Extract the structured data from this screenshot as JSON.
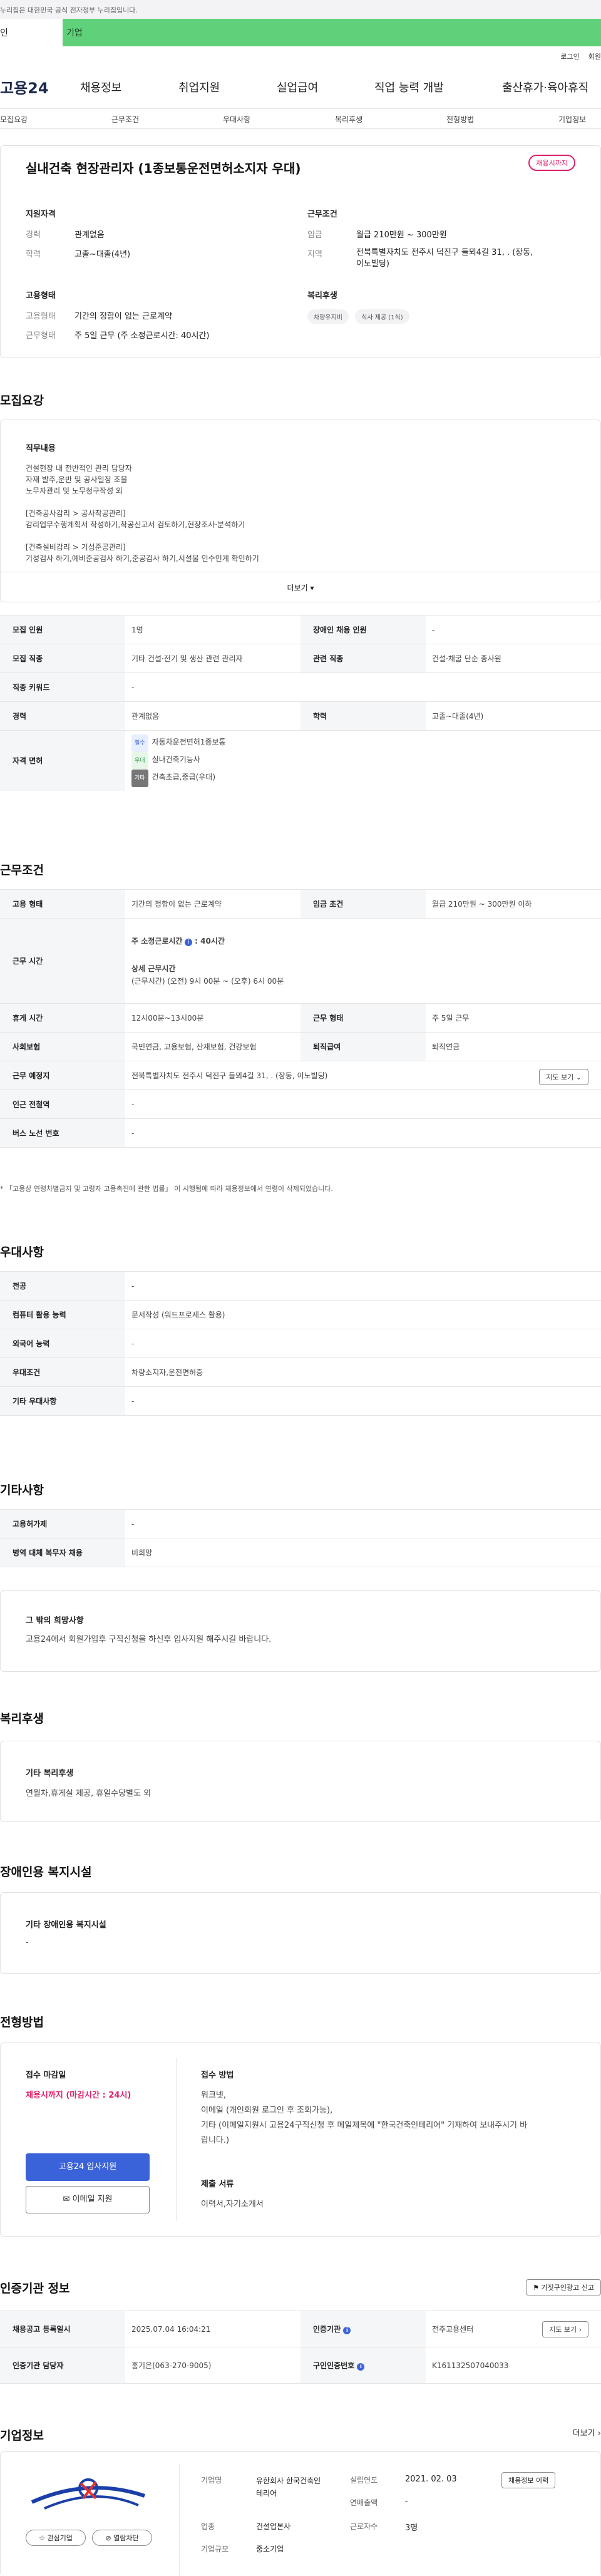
{
  "gov_banner": "누리집은 대한민국 공식 전자정부 누리집입니다.",
  "tabs": {
    "personal": "인",
    "corporate": "기업"
  },
  "util": {
    "login": "로그인",
    "join": "회원"
  },
  "logo": "고용24",
  "gnb": [
    "채용정보",
    "취업지원",
    "실업급여",
    "직업 능력 개발",
    "출산휴가·육아휴직"
  ],
  "subnav": [
    "모집요강",
    "근무조건",
    "우대사항",
    "복리후생",
    "전형방법",
    "기업정보"
  ],
  "job": {
    "title": "실내건축 현장관리자 (1종보통운전면허소지자 우대)",
    "status_badge": "채용시까지",
    "qualification_heading": "지원자격",
    "career_label": "경력",
    "career_value": "관계없음",
    "education_label": "학력",
    "education_value": "고졸~대졸(4년)",
    "conditions_heading": "근무조건",
    "wage_label": "임금",
    "wage_value": "월급 210만원 ~ 300만원",
    "region_label": "지역",
    "region_value": "전북특별자치도 전주시 덕진구 들뫼4길 31, . (장동, 이노빌딩)",
    "employment_heading": "고용형태",
    "emp_type_label": "고용형태",
    "emp_type_value": "기간의 정함이 없는 근로계약",
    "work_form_label": "근무형태",
    "work_form_value": "주 5일 근무 (주 소정근로시간: 40시간)",
    "welfare_heading": "복리후생",
    "welfare_chips": [
      "차량유지비",
      "식사 제공 (1식)"
    ]
  },
  "recruit": {
    "title": "모집요강",
    "duty_heading": "직무내용",
    "duty_lines": [
      "건설현장 내 전반적인 관리 담당자",
      "자재 발주,운반 및 공사일정 조율",
      "노무자관리 및 노무청구작성 외",
      "",
      "[건축공사감리 > 공사착공관리]",
      "감리업무수행계획서 작성하기,착공신고서 검토하기,현장조사·분석하기",
      "",
      "[건축설비감리 > 기성준공관리]",
      "기성검사 하기,예비준공검사 하기,준공검사 하기,시설물 인수인계 확인하기"
    ],
    "more": "더보기",
    "rows": [
      {
        "h1": "모집 인원",
        "v1": "1명",
        "h2": "장애인 채용 인원",
        "v2": "-"
      },
      {
        "h1": "모집 직종",
        "v1": "기타 건설·전기 및 생산 관련 관리자",
        "h2": "관련 직종",
        "v2": "건설·채굴 단순 종사원"
      },
      {
        "h1": "직종 키워드",
        "v1": "-",
        "h2": "",
        "v2": ""
      },
      {
        "h1": "경력",
        "v1": "관계없음",
        "h2": "학력",
        "v2": "고졸~대졸(4년)"
      }
    ],
    "license_label": "자격 면허",
    "licenses": [
      {
        "tag": "필수",
        "text": "자동차운전면허1종보통"
      },
      {
        "tag": "우대",
        "text": "실내건축기능사"
      },
      {
        "tag": "기타",
        "text": "건축초급,중급(우대)"
      }
    ]
  },
  "work": {
    "title": "근무조건",
    "emp_type_h": "고용 형태",
    "emp_type_v": "기간의 정함이 없는 근로계약",
    "wage_h": "임금 조건",
    "wage_v": "월급 210만원 ~ 300만원 이하",
    "hours_h": "근무 시간",
    "hours_week_label": "주 소정근로시간",
    "hours_week_value": ": 40시간",
    "hours_detail_label": "상세 근무시간",
    "hours_detail_value": "(근무시간) (오전) 9시 00분 ~ (오후) 6시 00분",
    "rest_h": "휴게 시간",
    "rest_v": "12시00분~13시00분",
    "form_h": "근무 형태",
    "form_v": "주 5일 근무",
    "insurance_h": "사회보험",
    "insurance_v": "국민연금, 고용보험, 산재보험, 건강보험",
    "pension_h": "퇴직급여",
    "pension_v": "퇴직연금",
    "place_h": "근무 예정지",
    "place_v": "전북특별자치도 전주시 덕진구 들뫼4길 31, . (장동, 이노빌딩)",
    "map_btn": "지도 보기",
    "subway_h": "인근 전철역",
    "subway_v": "-",
    "bus_h": "버스 노선 번호",
    "bus_v": "-",
    "footnote": "「고용상 연령차별금지 및 고령자 고용촉진에 관한 법률」 이 시행됨에 따라 채용정보에서 연령이 삭제되었습니다."
  },
  "pref": {
    "title": "우대사항",
    "rows": [
      {
        "h": "전공",
        "v": "-"
      },
      {
        "h": "컴퓨터 활용 능력",
        "v": "문서작성 (워드프로세스 활용)"
      },
      {
        "h": "외국어 능력",
        "v": "-"
      },
      {
        "h": "우대조건",
        "v": "차량소지자,운전면허증"
      },
      {
        "h": "기타 우대사항",
        "v": "-"
      }
    ]
  },
  "etc": {
    "title": "기타사항",
    "rows": [
      {
        "h": "고용허가제",
        "v": "-"
      },
      {
        "h": "병역 대체 복무자 채용",
        "v": "비희망"
      }
    ],
    "other_heading": "그 밖의 희망사항",
    "other_text": "고용24에서 회원가입후 구직신청을 하신후 입사지원 해주시길 바랍니다."
  },
  "welfare": {
    "title": "복리후생",
    "heading": "기타 복리후생",
    "text": "연월차,휴게실 제공, 휴일수당별도 외"
  },
  "disability": {
    "title": "장애인용 복지시설",
    "heading": "기타 장애인용 복지시설",
    "text": "-"
  },
  "selection": {
    "title": "전형방법",
    "deadline_heading": "접수 마감일",
    "deadline_value": "채용시까지 (마감시간 : 24시)",
    "apply_btn": "고용24 입사지원",
    "email_btn": "이메일 지원",
    "method_heading": "접수 방법",
    "method_lines": [
      "워크넷,",
      "이메일 (개인회원 로그인 후 조회가능),",
      "기타 (이메일지원시 고용24구직신청 후 메일제목에 \"한국건축인테리어\" 기재하여 보내주시기 바",
      "랍니다.)"
    ],
    "docs_heading": "제출 서류",
    "docs_value": "이력서,자기소개서"
  },
  "agency": {
    "title": "인증기관 정보",
    "report_btn": "거짓구인광고 신고",
    "rows": [
      {
        "h1": "채용공고 등록일시",
        "v1": "2025.07.04 16:04:21",
        "h2": "인증기관",
        "v2": "전주고용센터",
        "btn": "지도 보기"
      },
      {
        "h1": "인증기관 담당자",
        "v1": "홍기은(063-270-9005)",
        "h2": "구인인증번호",
        "v2": "K161132507040033",
        "btn": ""
      }
    ]
  },
  "company": {
    "title": "기업정보",
    "more": "더보기",
    "fav_btn": "관심기업",
    "view_btn": "열람차단",
    "name_label": "기업명",
    "name_value": "유한회사 한국건축인테리어",
    "year_label": "설립연도",
    "year_value": "2021. 02. 03",
    "sales_label": "연매출액",
    "sales_value": "-",
    "industry_label": "업종",
    "industry_value": "건설업본사",
    "size_label": "기업규모",
    "size_value": "중소기업",
    "staff_label": "근로자수",
    "staff_value": "3명",
    "list_btn": "채용정보 이력"
  }
}
